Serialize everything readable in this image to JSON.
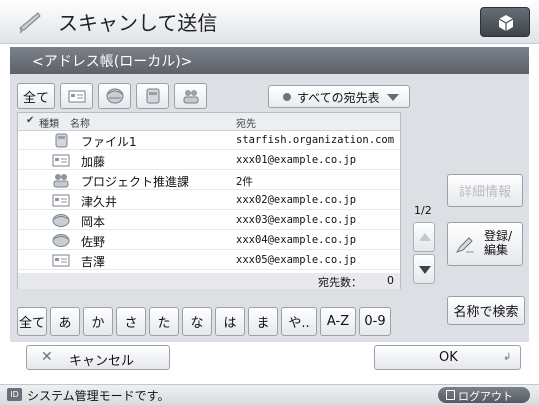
{
  "header": {
    "title": "スキャンして送信",
    "title_icon": "scan-send-icon",
    "home_icon": "cube-menu-icon"
  },
  "subheader": {
    "text": "<アドレス帳(ローカル)>"
  },
  "type_filter": {
    "all_label": "全て",
    "icons": [
      "email-type-icon",
      "group-type-icon",
      "file-type-icon",
      "ifax-type-icon"
    ]
  },
  "destination_select": {
    "value": "すべての宛先表"
  },
  "list": {
    "columns": {
      "check": "✔",
      "type": "種類",
      "name": "名称",
      "address": "宛先"
    },
    "rows": [
      {
        "type_icon": "file-icon",
        "name": "ファイル1",
        "address": "starfish.organization.com"
      },
      {
        "type_icon": "email-icon",
        "name": "加藤",
        "address": "xxx01@example.co.jp"
      },
      {
        "type_icon": "group-icon",
        "name": "プロジェクト推進課",
        "address": "2件"
      },
      {
        "type_icon": "email-icon",
        "name": "津久井",
        "address": "xxx02@example.co.jp"
      },
      {
        "type_icon": "ifax-icon",
        "name": "岡本",
        "address": "xxx03@example.co.jp"
      },
      {
        "type_icon": "ifax-icon",
        "name": "佐野",
        "address": "xxx04@example.co.jp"
      },
      {
        "type_icon": "email-icon",
        "name": "吉澤",
        "address": "xxx05@example.co.jp"
      }
    ],
    "count_label": "宛先数：",
    "count_value": "0"
  },
  "pagination": {
    "page": "1/2"
  },
  "detail_button": "詳細情報",
  "register_button": {
    "line1": "登録/",
    "line2": "編集"
  },
  "search_by_name_button": "名称で検索",
  "index_buttons": [
    "全て",
    "あ",
    "か",
    "さ",
    "た",
    "な",
    "は",
    "ま",
    "や..",
    "A-Z",
    "0-9"
  ],
  "footer": {
    "cancel": "キャンセル",
    "ok": "OK"
  },
  "status": {
    "badge": "ID",
    "text": "システム管理モードです。",
    "logout": "ログアウト"
  },
  "colors": {
    "accent": "#5c616a",
    "panel": "#dcdfe3"
  }
}
